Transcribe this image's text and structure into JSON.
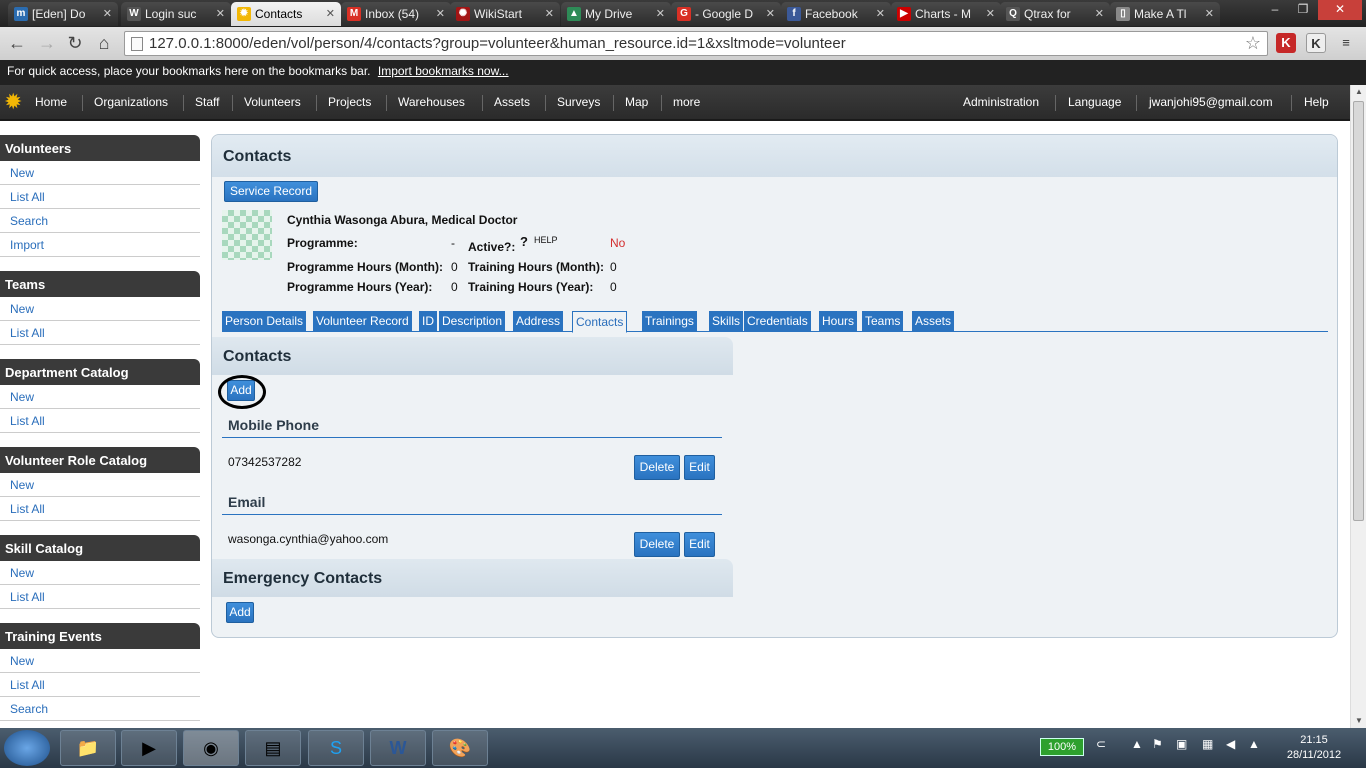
{
  "browser": {
    "tabs": [
      {
        "title": "[Eden] Do",
        "icon": "m-icon",
        "color": "#2b6cb0",
        "glyph": "m"
      },
      {
        "title": "Login suc",
        "icon": "wikipedia-icon",
        "color": "#555555",
        "glyph": "W"
      },
      {
        "title": "Contacts",
        "icon": "sun-icon",
        "color": "#f2b705",
        "glyph": "✹"
      },
      {
        "title": "Inbox (54)",
        "icon": "gmail-icon",
        "color": "#d93025",
        "glyph": "M"
      },
      {
        "title": "WikiStart",
        "icon": "trac-icon",
        "color": "#a31515",
        "glyph": "✺"
      },
      {
        "title": "My Drive",
        "icon": "drive-icon",
        "color": "#2e8b57",
        "glyph": "▲"
      },
      {
        "title": "- Google D",
        "icon": "google-icon",
        "color": "#d93025",
        "glyph": "G"
      },
      {
        "title": "Facebook",
        "icon": "facebook-icon",
        "color": "#3b5998",
        "glyph": "f"
      },
      {
        "title": "Charts - M",
        "icon": "youtube-icon",
        "color": "#cc0000",
        "glyph": "▶"
      },
      {
        "title": "Qtrax for",
        "icon": "qtrax-icon",
        "color": "#555555",
        "glyph": "Q"
      },
      {
        "title": "Make A Tl",
        "icon": "page-icon",
        "color": "#888888",
        "glyph": "▯"
      }
    ],
    "url": "127.0.0.1:8000/eden/vol/person/4/contacts?group=volunteer&human_resource.id=1&xsltmode=volunteer",
    "bookmarks_text": "For quick access, place your bookmarks here on the bookmarks bar.",
    "bookmarks_link": "Import bookmarks now..."
  },
  "appnav": {
    "left": [
      "Home",
      "Organizations",
      "Staff",
      "Volunteers",
      "Projects",
      "Warehouses",
      "Assets",
      "Surveys",
      "Map",
      "more"
    ],
    "right": [
      "Administration",
      "Language",
      "jwanjohi95@gmail.com",
      "Help"
    ]
  },
  "sidebar": [
    {
      "title": "Volunteers",
      "items": [
        "New",
        "List All",
        "Search",
        "Import"
      ]
    },
    {
      "title": "Teams",
      "items": [
        "New",
        "List All"
      ]
    },
    {
      "title": "Department Catalog",
      "items": [
        "New",
        "List All"
      ]
    },
    {
      "title": "Volunteer Role Catalog",
      "items": [
        "New",
        "List All"
      ]
    },
    {
      "title": "Skill Catalog",
      "items": [
        "New",
        "List All"
      ]
    },
    {
      "title": "Training Events",
      "items": [
        "New",
        "List All",
        "Search"
      ]
    }
  ],
  "main": {
    "title": "Contacts",
    "service_record": "Service Record",
    "person_name": "Cynthia Wasonga Abura, Medical Doctor",
    "programme_label": "Programme:",
    "programme_value": "-",
    "active_label": "Active?:",
    "help_mark": "?",
    "help_text": "HELP",
    "active_value": "No",
    "prog_hours_month_label": "Programme Hours (Month):",
    "prog_hours_month_value": "0",
    "training_hours_month_label": "Training Hours (Month):",
    "training_hours_month_value": "0",
    "prog_hours_year_label": "Programme Hours (Year):",
    "prog_hours_year_value": "0",
    "training_hours_year_label": "Training Hours (Year):",
    "training_hours_year_value": "0",
    "tabs": [
      "Person Details",
      "Volunteer Record",
      "ID",
      "Description",
      "Address",
      "Contacts",
      "Trainings",
      "Skills",
      "Credentials",
      "Hours",
      "Teams",
      "Assets"
    ],
    "active_tab": "Contacts",
    "contacts_heading": "Contacts",
    "add_label": "Add",
    "mobile_title": "Mobile Phone",
    "mobile_value": "07342537282",
    "email_title": "Email",
    "email_value": "wasonga.cynthia@yahoo.com",
    "delete_label": "Delete",
    "edit_label": "Edit",
    "emergency_heading": "Emergency Contacts"
  },
  "taskbar": {
    "battery": "100%",
    "time": "21:15",
    "date": "28/11/2012"
  }
}
